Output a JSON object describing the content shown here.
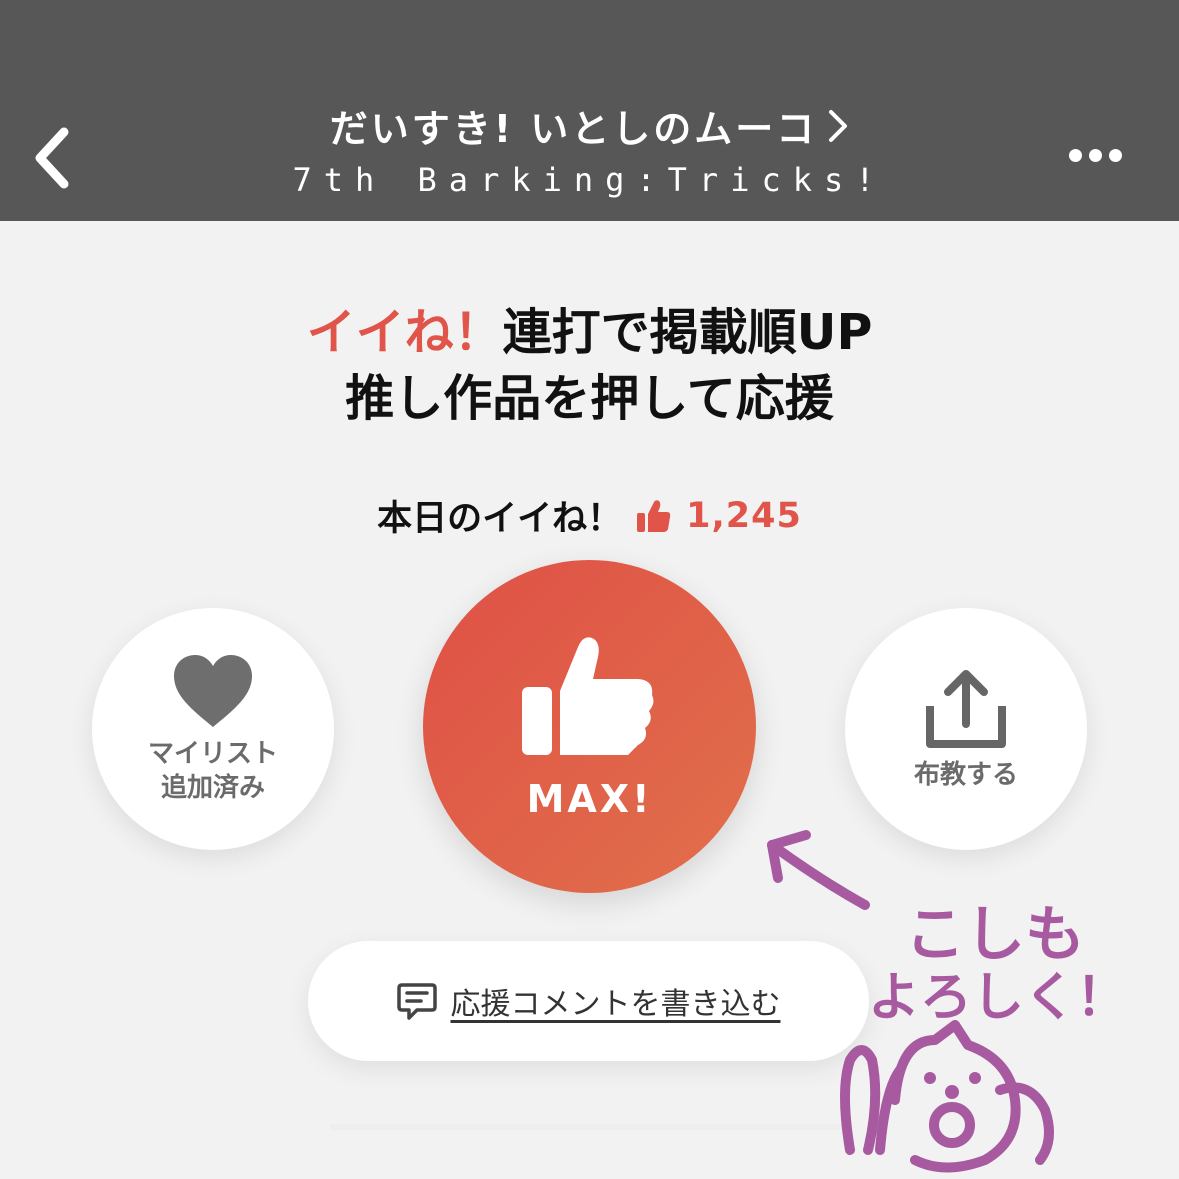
{
  "header": {
    "title": "だいすき! いとしのムーコ",
    "chevron": "›",
    "subtitle": "7th Barking:Tricks!",
    "back_icon": "chevron-left-icon",
    "more_icon": "more-horizontal-icon"
  },
  "headline": {
    "accent": "イイね！",
    "line1_rest": "連打で掲載順UP",
    "line2": "推し作品を押して応援"
  },
  "today": {
    "label": "本日のイイね！",
    "count": "1,245"
  },
  "actions": {
    "mylist_line1": "マイリスト",
    "mylist_line2": "追加済み",
    "like_label": "MAX!",
    "share_label": "布教する"
  },
  "comment": {
    "label": "応援コメントを書き込む"
  },
  "doodle": {
    "line1": "こしも",
    "line2": "よろしく！"
  },
  "colors": {
    "header_bg": "#575757",
    "accent": "#e0544a",
    "background": "#f2f2f2",
    "doodle": "#a85aa0"
  }
}
